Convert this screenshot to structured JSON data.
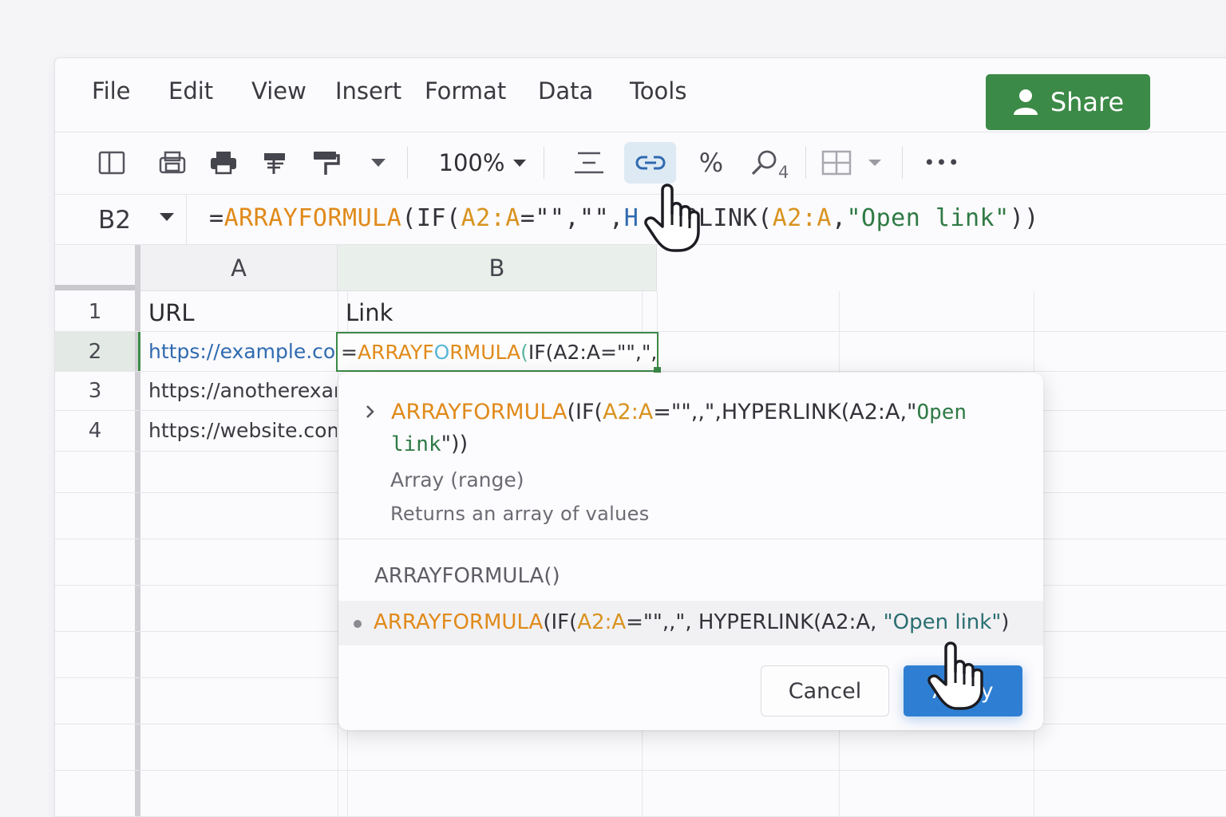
{
  "menu": {
    "items": [
      "File",
      "Edit",
      "View",
      "Insert",
      "Format",
      "Data",
      "Tools"
    ],
    "share_label": "Share"
  },
  "toolbar": {
    "zoom": "100%",
    "percent_label": "%",
    "find_subscript": "4",
    "more_label": "•••",
    "icons": [
      "panel-icon",
      "print-preview-icon",
      "print-icon",
      "paint-format-icon",
      "paint-roller-icon",
      "dropdown-icon",
      "align-icon",
      "link-icon",
      "percent-icon",
      "find-icon",
      "borders-icon",
      "more-icon"
    ]
  },
  "formula_bar": {
    "cell_ref": "B2",
    "parts": [
      "=",
      "ARRAYFORMULA",
      "(IF(",
      "A2:A",
      "=\"\",\"\",",
      "H",
      "RLINK(",
      "A2:A",
      ",",
      "\"Open link\"",
      "))"
    ]
  },
  "grid": {
    "columns": [
      "A",
      "B"
    ],
    "rows": [
      "1",
      "2",
      "3",
      "4"
    ],
    "a_cells": [
      "URL",
      "https://example.com",
      "https://anotherexample.com",
      "https://website.com"
    ],
    "b1": "Link",
    "b2_parts": [
      "=",
      "ARRAYF",
      "O",
      "RMULA",
      "(",
      "IF(A2:A=\"\",\",",
      ")"
    ]
  },
  "popup": {
    "signature_parts": [
      "ARRAYFORMULA",
      "(IF(",
      "A2:A",
      "=\"\",,\",HYPERLINK(A2:A,\"",
      "Open link",
      "\"))"
    ],
    "argument": "Array (range)",
    "description": "Returns an array of values",
    "suggestion_header": "ARRAYFORMULA()",
    "suggestion_parts": [
      "ARRAYFORMULA",
      "(IF(",
      "A2:A",
      "=\"\",,\", HYPERLINK(A2:A, ",
      "\"Open link\"",
      ")"
    ],
    "cancel_label": "Cancel",
    "apply_label": "Apply"
  },
  "colors": {
    "accent_green": "#3c8a47",
    "accent_blue": "#2e7fd3",
    "function_orange": "#e08a1a",
    "string_green": "#2f7a45",
    "link_blue": "#2f6ab0"
  }
}
